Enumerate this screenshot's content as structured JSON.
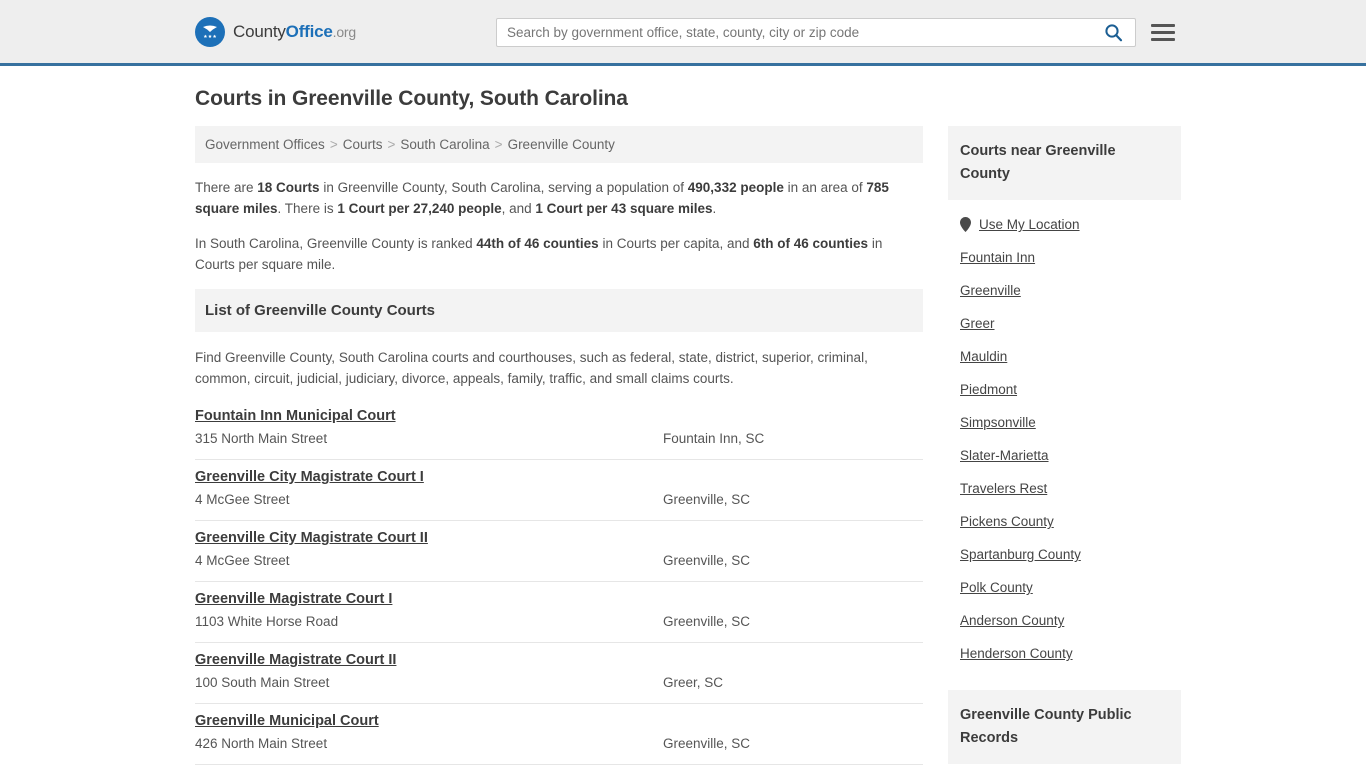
{
  "header": {
    "brand": {
      "part1": "County",
      "part2": "Office",
      "part3": ".org",
      "logo_icon": "eagle-shield-icon"
    },
    "search": {
      "placeholder": "Search by government office, state, county, city or zip code",
      "value": "",
      "icon": "search-icon"
    },
    "menu_icon": "hamburger-menu-icon",
    "accent_color": "#37719f"
  },
  "main": {
    "page_title": "Courts in Greenville County, South Carolina",
    "breadcrumb": {
      "separator": ">",
      "items": [
        "Government Offices",
        "Courts",
        "South Carolina",
        "Greenville County"
      ]
    },
    "stats": {
      "p1_parts": [
        {
          "text": "There are ",
          "bold": false
        },
        {
          "text": "18 Courts",
          "bold": true
        },
        {
          "text": " in Greenville County, South Carolina, serving a population of ",
          "bold": false
        },
        {
          "text": "490,332 people",
          "bold": true
        },
        {
          "text": " in an area of ",
          "bold": false
        },
        {
          "text": "785 square miles",
          "bold": true
        },
        {
          "text": ". There is ",
          "bold": false
        },
        {
          "text": "1 Court per 27,240 people",
          "bold": true
        },
        {
          "text": ", and ",
          "bold": false
        },
        {
          "text": "1 Court per 43 square miles",
          "bold": true
        },
        {
          "text": ".",
          "bold": false
        }
      ],
      "p2_parts": [
        {
          "text": "In South Carolina, Greenville County is ranked ",
          "bold": false
        },
        {
          "text": "44th of 46 counties",
          "bold": true
        },
        {
          "text": " in Courts per capita, and ",
          "bold": false
        },
        {
          "text": "6th of 46 counties",
          "bold": true
        },
        {
          "text": " in Courts per square mile.",
          "bold": false
        }
      ]
    },
    "list_section": {
      "heading": "List of Greenville County Courts",
      "description": "Find Greenville County, South Carolina courts and courthouses, such as federal, state, district, superior, criminal, common, circuit, judicial, judiciary, divorce, appeals, family, traffic, and small claims courts."
    },
    "courts": [
      {
        "name": "Fountain Inn Municipal Court",
        "address": "315 North Main Street",
        "city": "Fountain Inn, SC"
      },
      {
        "name": "Greenville City Magistrate Court I",
        "address": "4 McGee Street",
        "city": "Greenville, SC"
      },
      {
        "name": "Greenville City Magistrate Court II",
        "address": "4 McGee Street",
        "city": "Greenville, SC"
      },
      {
        "name": "Greenville Magistrate Court I",
        "address": "1103 White Horse Road",
        "city": "Greenville, SC"
      },
      {
        "name": "Greenville Magistrate Court II",
        "address": "100 South Main Street",
        "city": "Greer, SC"
      },
      {
        "name": "Greenville Municipal Court",
        "address": "426 North Main Street",
        "city": "Greenville, SC"
      }
    ]
  },
  "sidebar": {
    "nearby_panel": {
      "heading": "Courts near Greenville County",
      "location_link": {
        "label": "Use My Location",
        "icon": "map-pin-icon"
      },
      "links": [
        "Fountain Inn",
        "Greenville",
        "Greer",
        "Mauldin",
        "Piedmont",
        "Simpsonville",
        "Slater-Marietta",
        "Travelers Rest",
        "Pickens County",
        "Spartanburg County",
        "Polk County",
        "Anderson County",
        "Henderson County"
      ]
    },
    "records_panel": {
      "heading": "Greenville County Public Records"
    }
  }
}
